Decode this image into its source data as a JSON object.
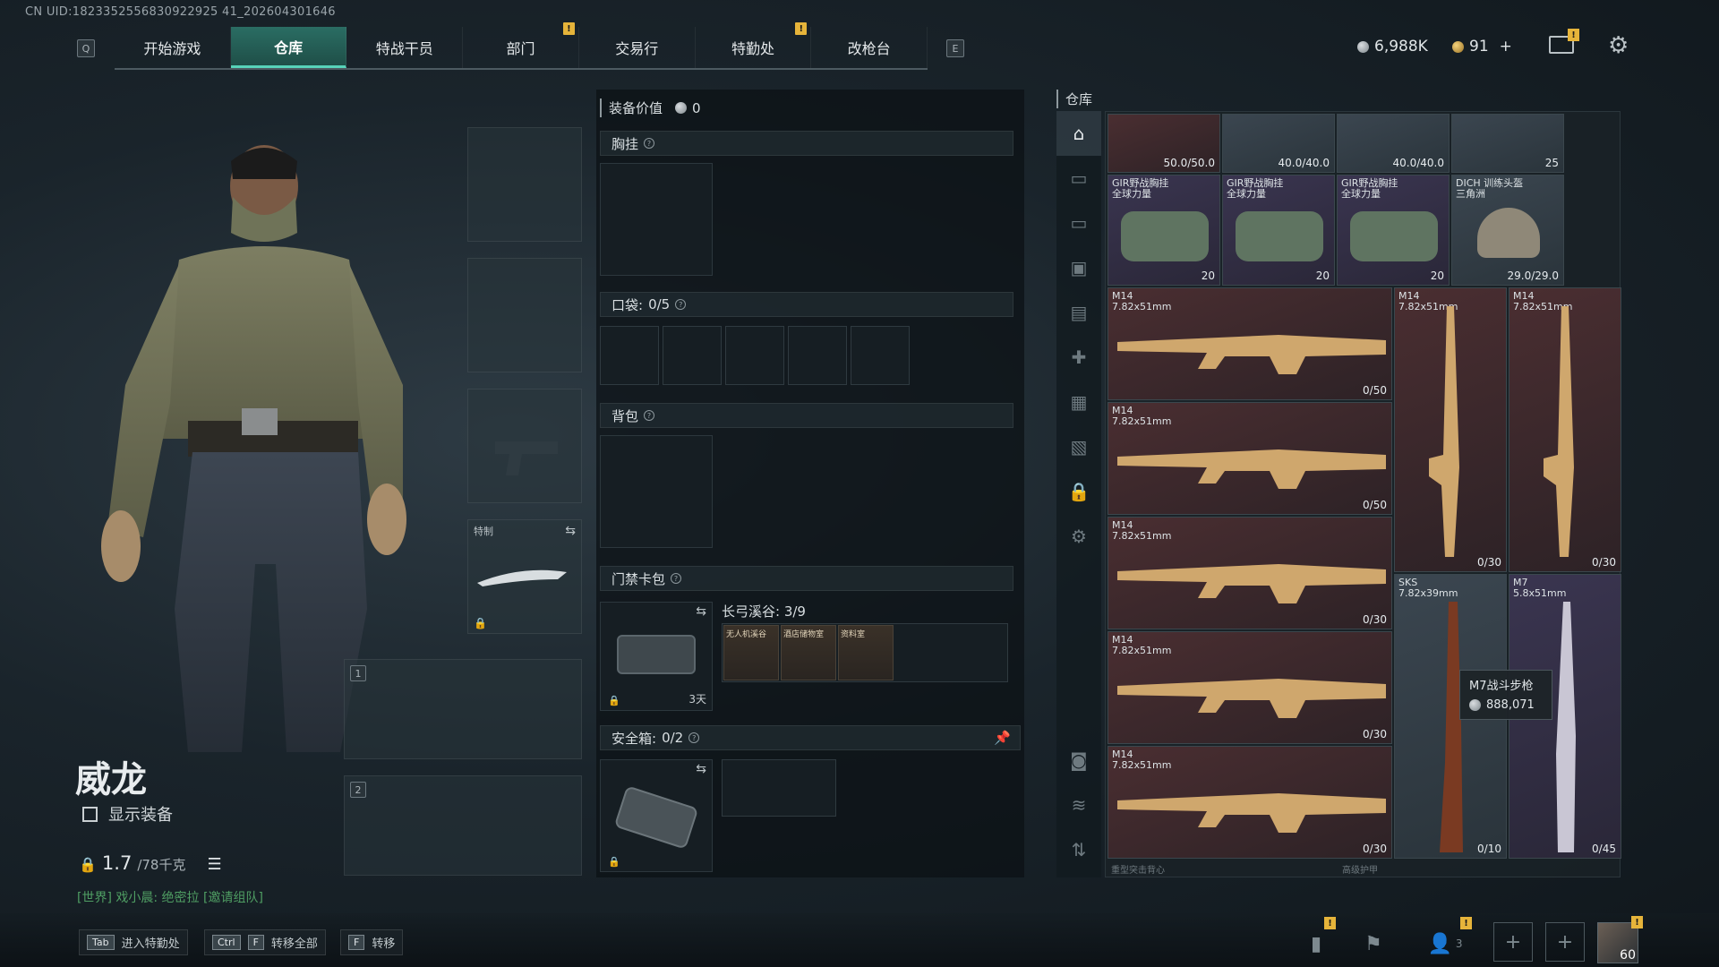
{
  "uid": "CN UID:1823352556830922925 41_202604301646",
  "nav": {
    "left_key": "Q",
    "right_key": "E",
    "tabs": [
      {
        "label": "开始游戏",
        "warn": false
      },
      {
        "label": "仓库",
        "warn": false,
        "active": true
      },
      {
        "label": "特战干员",
        "warn": false
      },
      {
        "label": "部门",
        "warn": true
      },
      {
        "label": "交易行",
        "warn": false
      },
      {
        "label": "特勤处",
        "warn": true
      },
      {
        "label": "改枪台",
        "warn": false
      }
    ]
  },
  "currency": {
    "silver": "6,988K",
    "gold": "91",
    "plus": "+"
  },
  "character": {
    "name": "威龙",
    "show_equip": "显示装备",
    "weight": "1.7",
    "weight_max": "/78千克",
    "world_msg": "[世界] 戏小晨: 绝密拉 [邀请组队]"
  },
  "slots": {
    "melee_label": "特制",
    "slot1": "1",
    "slot2": "2"
  },
  "mid": {
    "equip_value_label": "装备价值",
    "equip_value": "0",
    "chest_label": "胸挂",
    "pocket_label": "口袋:",
    "pocket_value": "0/5",
    "backpack_label": "背包",
    "keycard_label": "门禁卡包",
    "keycard_map": "长弓溪谷: 3/9",
    "keycard_time": "3天",
    "cards": [
      "无人机溪谷",
      "酒店储物室",
      "资料室"
    ],
    "safebox_label": "安全箱:",
    "safebox_value": "0/2"
  },
  "warehouse": {
    "title": "仓库",
    "top_items": [
      {
        "dur": "50.0/50.0"
      },
      {
        "dur": "40.0/40.0"
      },
      {
        "dur": "40.0/40.0"
      },
      {
        "dur": "25"
      }
    ],
    "row2": [
      {
        "name": "GIR野战胸挂",
        "sub": "全球力量",
        "count": "20"
      },
      {
        "name": "GIR野战胸挂",
        "sub": "全球力量",
        "count": "20"
      },
      {
        "name": "GIR野战胸挂",
        "sub": "全球力量",
        "count": "20"
      },
      {
        "name": "DICH 训练头盔",
        "sub": "三角洲",
        "dur": "29.0/29.0"
      }
    ],
    "guns": [
      {
        "name": "M14",
        "caliber": "7.82x51mm",
        "ammo": "0/50"
      },
      {
        "name": "M14",
        "caliber": "7.82x51mm",
        "ammo": "0/50"
      },
      {
        "name": "M14",
        "caliber": "7.82x51mm",
        "ammo": "0/30"
      },
      {
        "name": "M14",
        "caliber": "7.82x51mm",
        "ammo": "0/30"
      },
      {
        "name": "M14",
        "caliber": "7.82x51mm",
        "ammo": "0/30"
      }
    ],
    "vguns": [
      {
        "name": "M14",
        "caliber": "7.82x51mm",
        "ammo": "0/30"
      },
      {
        "name": "M14",
        "caliber": "7.82x51mm",
        "ammo": "0/30"
      },
      {
        "name": "SKS",
        "caliber": "7.82x39mm",
        "ammo": "0/10"
      },
      {
        "name": "M7",
        "caliber": "5.8x51mm",
        "ammo": "0/45"
      }
    ],
    "tooltip_name": "M7战斗步枪",
    "tooltip_price": "888,071",
    "bottom_left": "重型突击背心",
    "bottom_mid": "高级护甲"
  },
  "bottom": {
    "hint1_key": "Tab",
    "hint1_label": "进入特勤处",
    "hint2_key1": "Ctrl",
    "hint2_key2": "F",
    "hint2_label": "转移全部",
    "hint3_key": "F",
    "hint3_label": "转移",
    "friends_count": "3",
    "level": "60"
  }
}
